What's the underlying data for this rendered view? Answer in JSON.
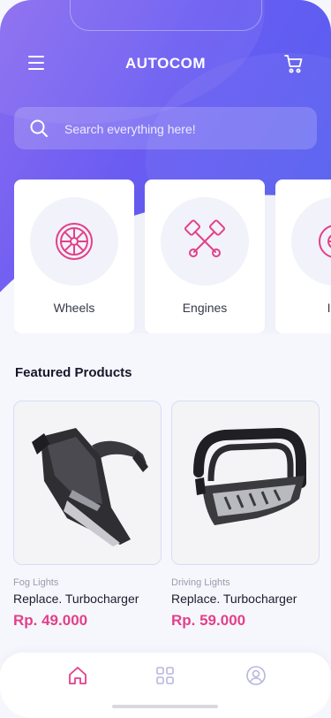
{
  "header": {
    "title": "AUTOCOM"
  },
  "search": {
    "placeholder": "Search everything here!"
  },
  "categories": [
    {
      "label": "Wheels",
      "icon": "wheel-icon"
    },
    {
      "label": "Engines",
      "icon": "pistons-icon"
    },
    {
      "label": "Ins",
      "icon": "turbo-icon"
    }
  ],
  "featured": {
    "title": "Featured Products",
    "products": [
      {
        "category": "Fog Lights",
        "name": "Replace. Turbocharger",
        "price": "Rp. 49.000",
        "image": "air-intake-image"
      },
      {
        "category": "Driving Lights",
        "name": "Replace. Turbocharger",
        "price": "Rp. 59.000",
        "image": "bull-bar-image"
      }
    ]
  },
  "bottom_nav": [
    "home-icon",
    "grid-icon",
    "profile-icon"
  ],
  "colors": {
    "accent": "#e3408a",
    "brand_start": "#8a6cf0",
    "brand_end": "#4f5ff0"
  }
}
